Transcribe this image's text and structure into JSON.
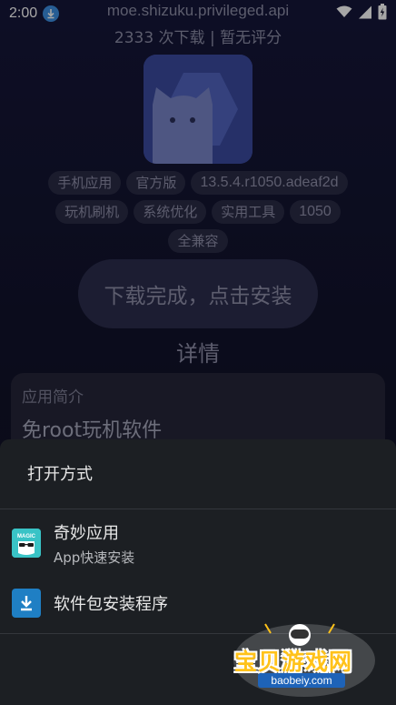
{
  "status_bar": {
    "time": "2:00",
    "icons": [
      "download-notification-icon",
      "wifi-icon",
      "signal-icon",
      "battery-charging-icon"
    ]
  },
  "app": {
    "package_name": "moe.shizuku.privileged.api",
    "download_info": "2333 次下载 | 暂无评分",
    "tags": [
      "手机应用",
      "官方版",
      "13.5.4.r1050.adeaf2d",
      "玩机刷机",
      "系统优化",
      "实用工具",
      "1050",
      "全兼容"
    ],
    "install_button": "下载完成，点击安装",
    "details_heading": "详情",
    "intro_label": "应用简介",
    "intro_text": "免root玩机软件"
  },
  "sheet": {
    "title": "打开方式",
    "options": [
      {
        "name": "奇妙应用",
        "sub": "App快速安装",
        "icon": "magic-app-icon",
        "icon_label": "MAGIC"
      },
      {
        "name": "软件包安装程序",
        "sub": "",
        "icon": "package-installer-icon"
      }
    ]
  },
  "watermark": {
    "text": "宝贝游戏网",
    "url": "baobeiy.com"
  },
  "colors": {
    "page_bg": "#12132c",
    "sheet_bg": "#1c1f23",
    "accent_blue": "#3d8fe3",
    "watermark_yellow": "#ffc21a"
  }
}
